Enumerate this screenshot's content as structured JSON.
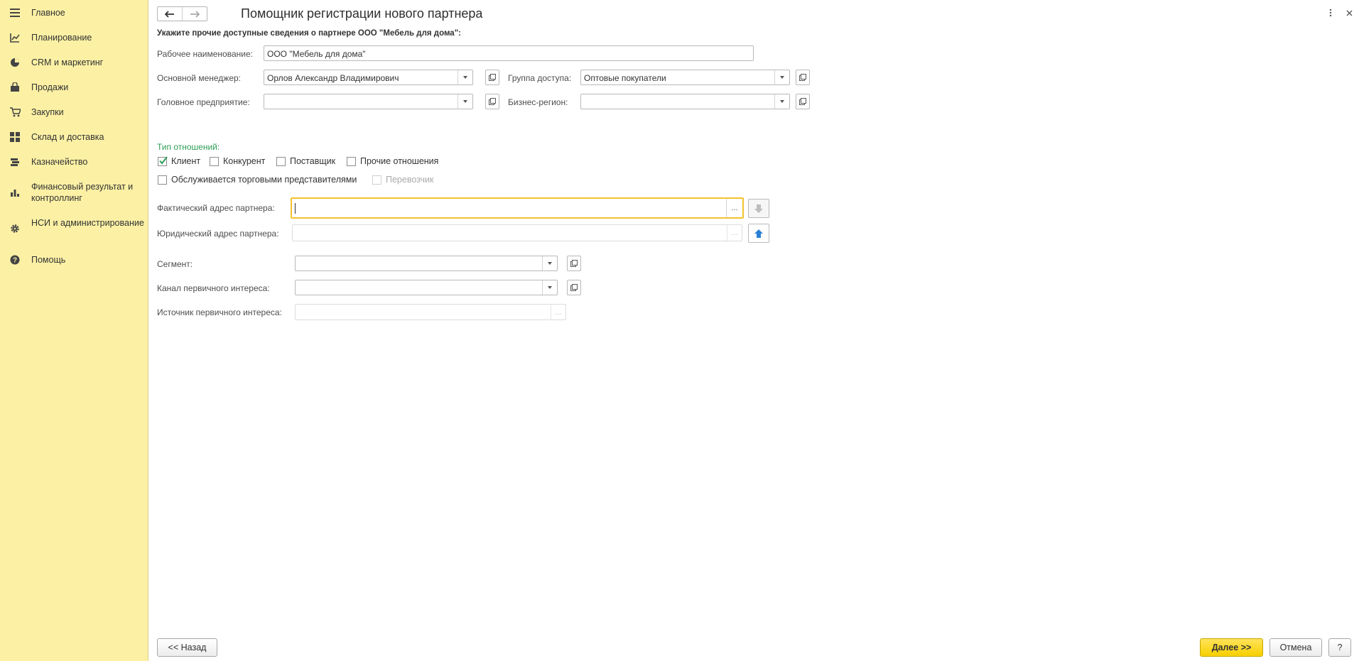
{
  "sidebar": {
    "items": [
      {
        "label": "Главное",
        "icon": "menu-icon"
      },
      {
        "label": "Планирование",
        "icon": "planning-icon"
      },
      {
        "label": "CRM и маркетинг",
        "icon": "pie-chart-icon"
      },
      {
        "label": "Продажи",
        "icon": "bag-icon"
      },
      {
        "label": "Закупки",
        "icon": "cart-icon"
      },
      {
        "label": "Склад и доставка",
        "icon": "warehouse-icon"
      },
      {
        "label": "Казначейство",
        "icon": "treasury-icon"
      },
      {
        "label": "Финансовый результат и контроллинг",
        "icon": "bar-chart-icon"
      },
      {
        "label": "НСИ и администрирование",
        "icon": "gear-icon"
      },
      {
        "label": "Помощь",
        "icon": "help-icon"
      }
    ]
  },
  "header": {
    "title": "Помощник регистрации нового партнера"
  },
  "form": {
    "subtitle": "Укажите прочие доступные сведения о партнере ООО \"Мебель для дома\":",
    "work_name_label": "Рабочее наименование:",
    "work_name_value": "ООО \"Мебель для дома\"",
    "manager_label": "Основной менеджер:",
    "manager_value": "Орлов Александр Владимирович",
    "access_group_label": "Группа доступа:",
    "access_group_value": "Оптовые покупатели",
    "head_company_label": "Головное предприятие:",
    "head_company_value": "",
    "business_region_label": "Бизнес-регион:",
    "business_region_value": "",
    "relations_title": "Тип отношений:",
    "checkboxes": {
      "client": {
        "label": "Клиент",
        "checked": true
      },
      "competitor": {
        "label": "Конкурент",
        "checked": false
      },
      "supplier": {
        "label": "Поставщик",
        "checked": false
      },
      "other": {
        "label": "Прочие отношения",
        "checked": false
      },
      "sales_reps": {
        "label": "Обслуживается торговыми представителями",
        "checked": false
      },
      "carrier": {
        "label": "Перевозчик",
        "checked": false,
        "disabled": true
      }
    },
    "actual_address_label": "Фактический адрес партнера:",
    "actual_address_value": "",
    "legal_address_label": "Юридический адрес партнера:",
    "legal_address_value": "",
    "segment_label": "Сегмент:",
    "segment_value": "",
    "channel_label": "Канал первичного интереса:",
    "channel_value": "",
    "source_label": "Источник первичного интереса:",
    "source_value": "",
    "dots": "..."
  },
  "footer": {
    "back_label": "<< Назад",
    "next_label": "Далее >>",
    "cancel_label": "Отмена",
    "help_label": "?"
  },
  "colors": {
    "sidebar_bg": "#fbf0a4",
    "accent_green": "#2f9e57",
    "primary_button": "#f7d000",
    "focus_border": "#f2c230"
  }
}
